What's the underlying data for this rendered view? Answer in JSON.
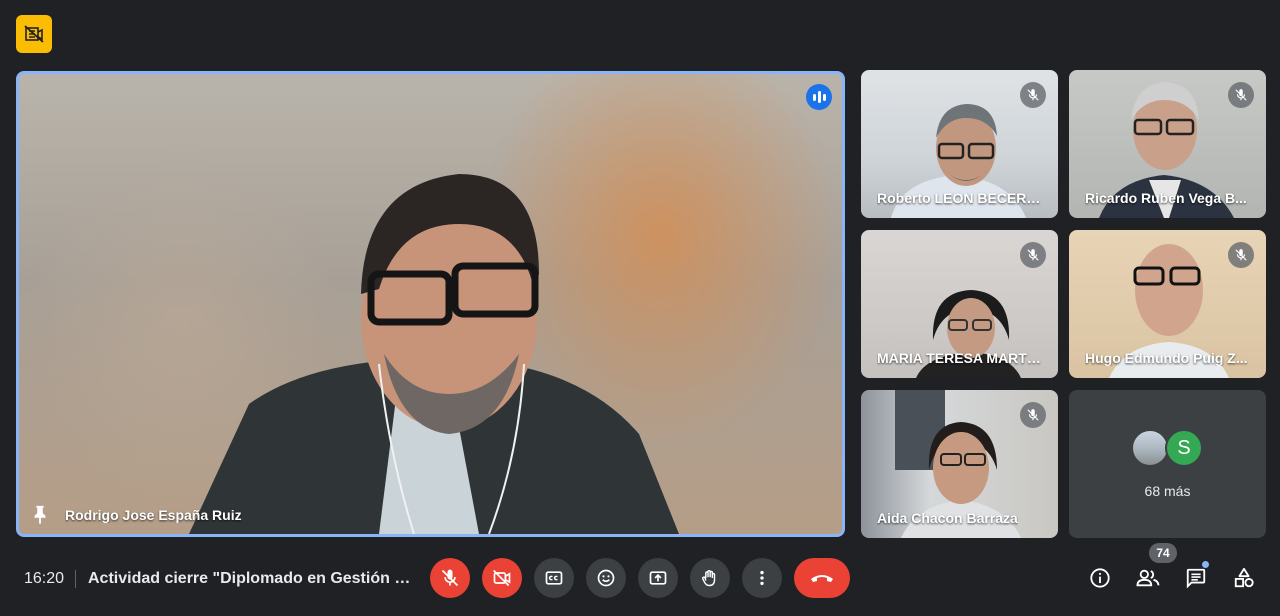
{
  "top": {
    "badge_icon": "camera-off-badge-icon"
  },
  "main_tile": {
    "name": "Rodrigo Jose España Ruiz",
    "speaking_icon": "speaking-indicator-icon",
    "pin_icon": "pin-icon"
  },
  "participants": [
    {
      "name": "Roberto LEON BECERRA",
      "muted": true
    },
    {
      "name": "Ricardo Ruben Vega B...",
      "muted": true
    },
    {
      "name": "MARIA TERESA MARTI...",
      "muted": true
    },
    {
      "name": "Hugo Edmundo Puig Z...",
      "muted": true
    },
    {
      "name": "Aida Chacon Barraza",
      "muted": true
    }
  ],
  "more": {
    "label": "68 más",
    "avatar_letter": "S"
  },
  "bottom": {
    "time": "16:20",
    "meeting_title": "Actividad cierre \"Diplomado en Gestión P...",
    "participant_count": "74"
  },
  "colors": {
    "background": "#202124",
    "accent_blue": "#8ab4f8",
    "danger_red": "#ea4335",
    "badge_yellow": "#fbbc04",
    "control_gray": "#3c4043"
  }
}
